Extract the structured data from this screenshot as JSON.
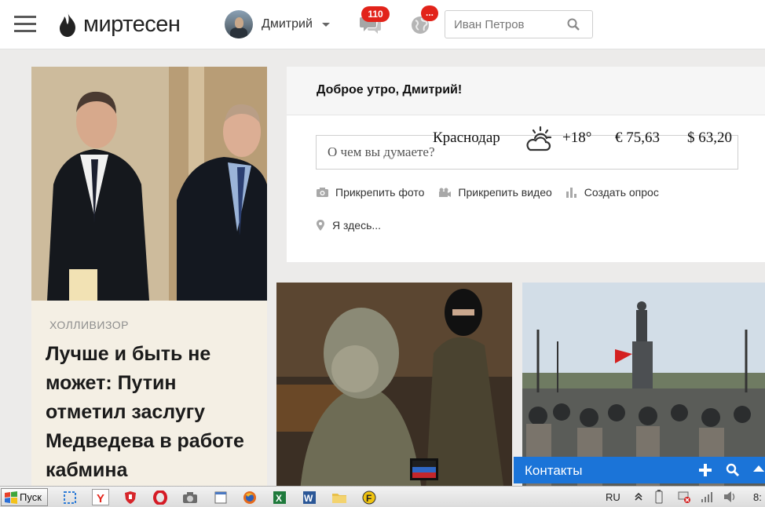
{
  "header": {
    "logo_text": "миртесен",
    "user_name": "Дмитрий",
    "messages_count": "110",
    "notifications_badge": "...",
    "search_placeholder": "Иван Петров"
  },
  "news_main": {
    "tag": "ХОЛЛИВИЗОР",
    "title": "Лучше и быть не может: Путин отметил заслугу Медведева в работе кабмина"
  },
  "post": {
    "greeting": "Доброе утро, Дмитрий!",
    "input_placeholder": "О чем вы думаете?",
    "actions": [
      {
        "label": "Прикрепить фото",
        "icon": "camera-icon"
      },
      {
        "label": "Прикрепить видео",
        "icon": "video-icon"
      },
      {
        "label": "Создать опрос",
        "icon": "poll-icon"
      }
    ],
    "location_label": "Я здесь..."
  },
  "weather": {
    "city": "Краснодар",
    "icon": "partly-cloudy-icon",
    "temperature": "+18°",
    "eur": "€ 75,63",
    "usd": "$ 63,20"
  },
  "contacts": {
    "label": "Контакты"
  },
  "taskbar": {
    "start_label": "Пуск",
    "icons": [
      "screenshot-tool-icon",
      "yandex-browser-icon",
      "antivirus-shield-icon",
      "opera-icon",
      "camera-app-icon",
      "window-icon",
      "firefox-icon",
      "excel-icon",
      "word-icon",
      "folder-icon",
      "skype-icon"
    ],
    "language": "RU",
    "clock": "8:"
  },
  "colors": {
    "accent_blue": "#1b74d8",
    "badge_red": "#e2231a",
    "card_beige": "#f4efe4",
    "page_bg": "#ecebea"
  }
}
